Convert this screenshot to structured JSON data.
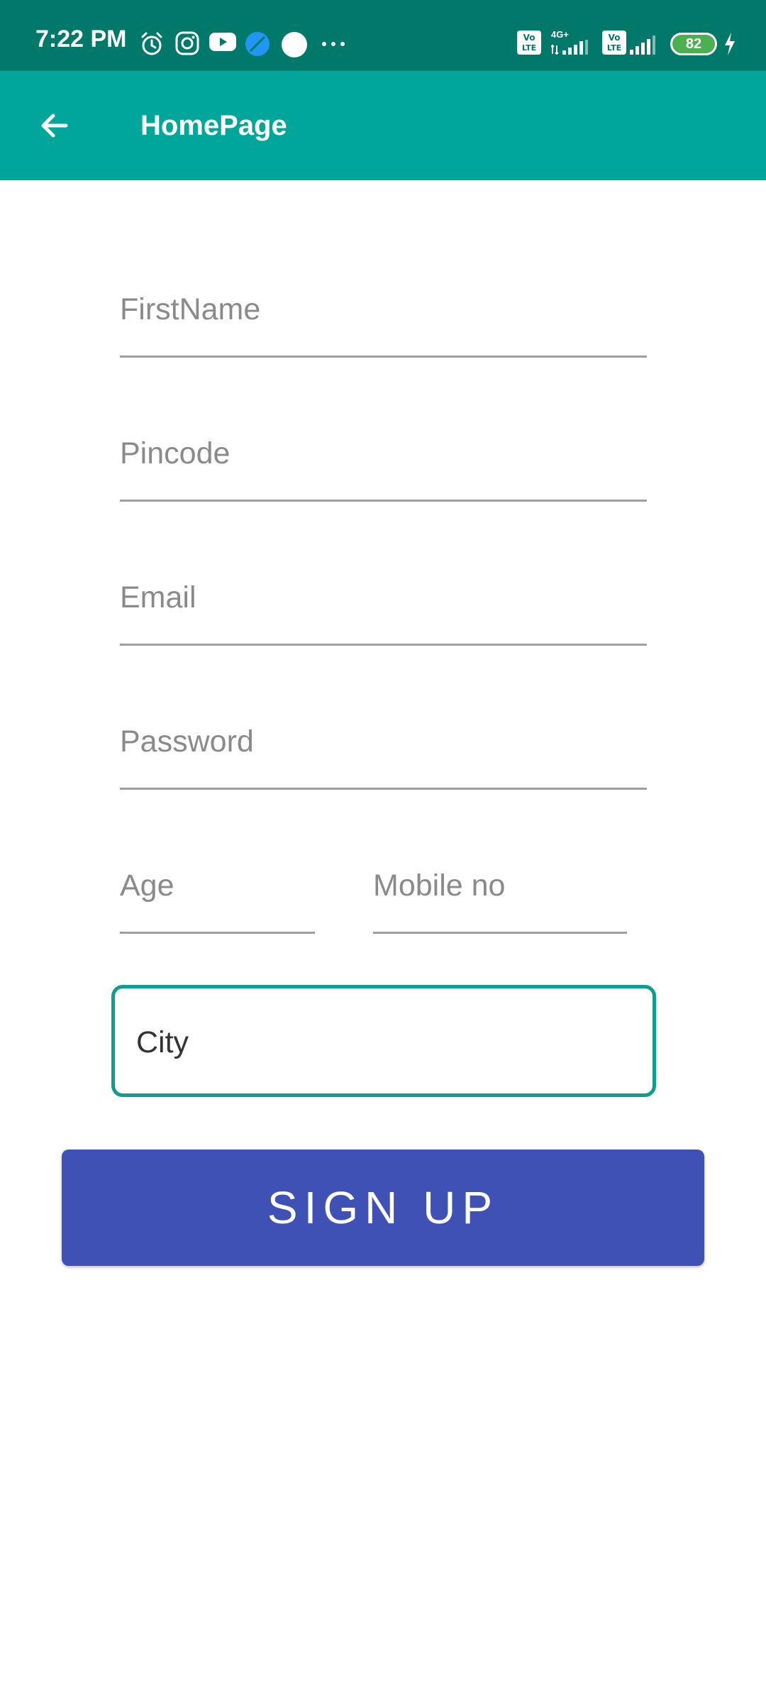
{
  "status_bar": {
    "time": "7:22 PM",
    "battery_level": "82",
    "icons": [
      "alarm-icon",
      "instagram-icon",
      "youtube-icon",
      "browser-icon",
      "dot-icon",
      "more-icon",
      "volte-icon",
      "signal-icon",
      "battery-icon",
      "charging-icon"
    ],
    "network_label": "4G+"
  },
  "app_bar": {
    "title": "HomePage",
    "back_icon": "arrow-back-icon",
    "color": "#00a69a"
  },
  "form": {
    "first_name_placeholder": "FirstName",
    "pincode_placeholder": "Pincode",
    "email_placeholder": "Email",
    "password_placeholder": "Password",
    "age_placeholder": "Age",
    "mobile_placeholder": "Mobile no",
    "city_value": "City",
    "accent_color": "#0f9d8f"
  },
  "signup": {
    "label": "SIGN UP",
    "color": "#3f51b5"
  }
}
